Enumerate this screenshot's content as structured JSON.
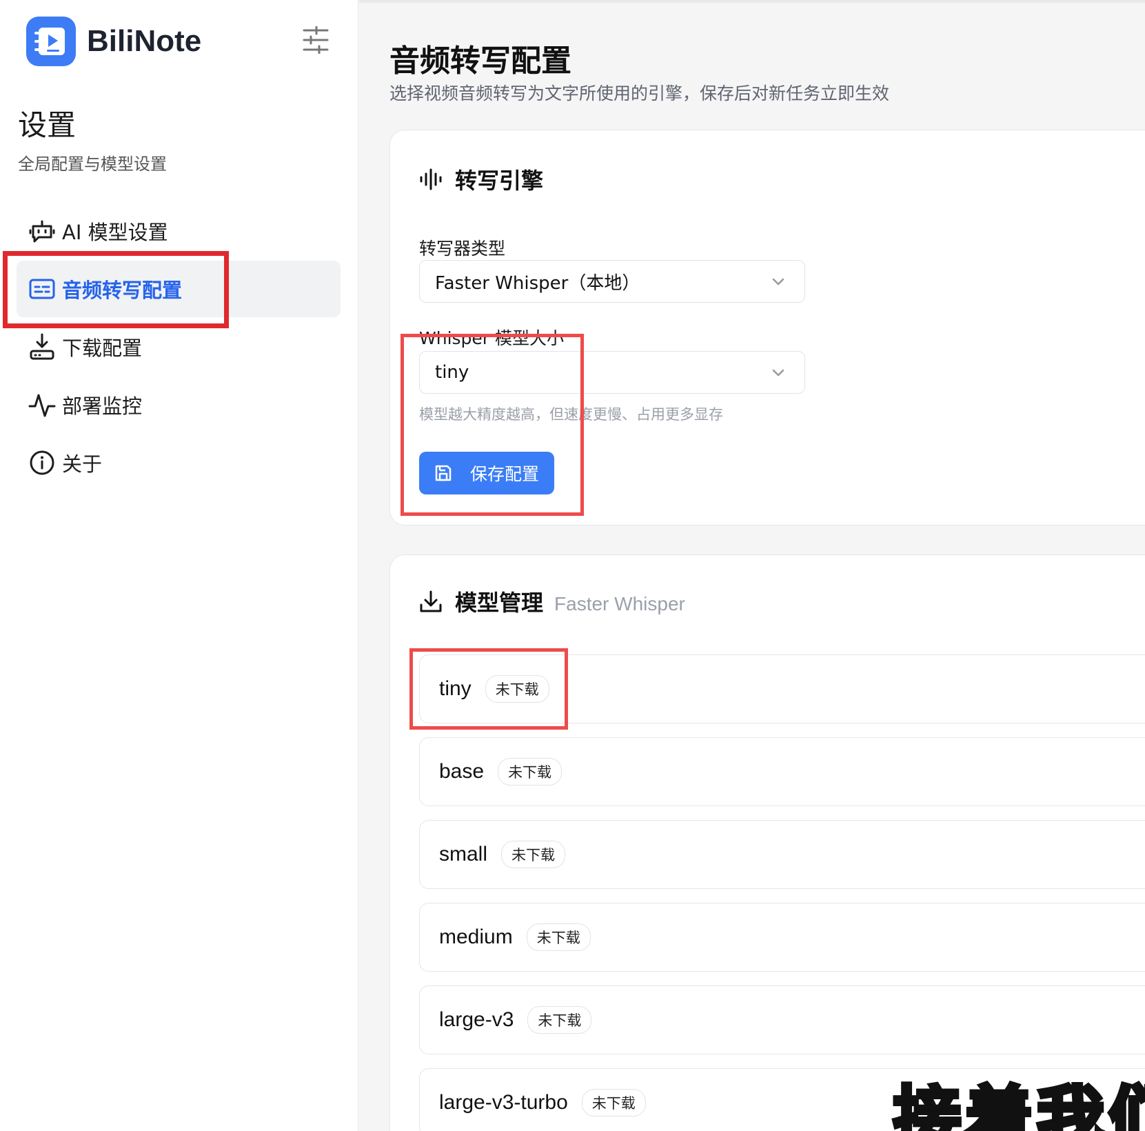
{
  "brand": {
    "name": "BiliNote"
  },
  "sidebar": {
    "title": "设置",
    "subtitle": "全局配置与模型设置",
    "items": [
      {
        "label": "AI 模型设置",
        "icon": "robot-icon"
      },
      {
        "label": "音频转写配置",
        "icon": "transcript-icon",
        "active": true
      },
      {
        "label": "下载配置",
        "icon": "download-tray-icon"
      },
      {
        "label": "部署监控",
        "icon": "activity-icon"
      },
      {
        "label": "关于",
        "icon": "info-icon"
      }
    ]
  },
  "page": {
    "title": "音频转写配置",
    "description": "选择视频音频转写为文字所使用的引擎，保存后对新任务立即生效"
  },
  "engine_card": {
    "title": "转写引擎",
    "transcriber_label": "转写器类型",
    "transcriber_value": "Faster Whisper（本地）",
    "model_size_label": "Whisper 模型大小",
    "model_size_value": "tiny",
    "hint": "模型越大精度越高，但速度更慢、占用更多显存",
    "save_label": "保存配置"
  },
  "models_card": {
    "title": "模型管理",
    "subtitle": "Faster Whisper",
    "models": [
      {
        "name": "tiny",
        "status": "未下载"
      },
      {
        "name": "base",
        "status": "未下载"
      },
      {
        "name": "small",
        "status": "未下载"
      },
      {
        "name": "medium",
        "status": "未下载"
      },
      {
        "name": "large-v3",
        "status": "未下载"
      },
      {
        "name": "large-v3-turbo",
        "status": "未下载"
      }
    ]
  },
  "overlay_caption": "接着我们",
  "colors": {
    "accent": "#3b7df6",
    "active_text": "#2563eb",
    "annotation": "#e0292d"
  }
}
